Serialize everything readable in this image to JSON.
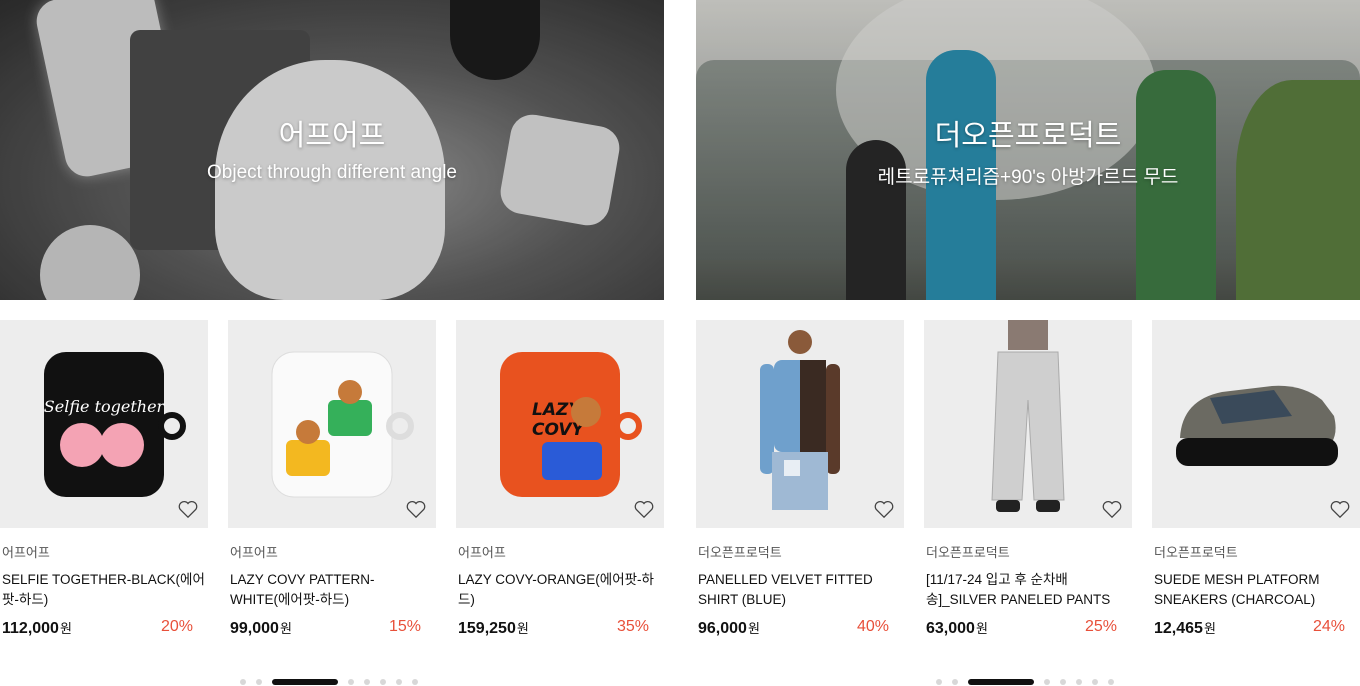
{
  "sections": [
    {
      "banner": {
        "title": "어프어프",
        "subtitle": "Object through different angle"
      },
      "products": [
        {
          "brand": "어프어프",
          "name": "SELFIE TOGETHER-BLACK(에어팟-하드)",
          "price": "112,000",
          "currency": "원",
          "discount": "20%",
          "thumb_color": "#111111",
          "thumb_icon": "airpods-case-icon"
        },
        {
          "brand": "어프어프",
          "name": "LAZY COVY PATTERN-WHITE(에어팟-하드)",
          "price": "99,000",
          "currency": "원",
          "discount": "15%",
          "thumb_color": "#f5f5f5",
          "thumb_icon": "airpods-case-icon"
        },
        {
          "brand": "어프어프",
          "name": "LAZY COVY-ORANGE(에어팟-하드)",
          "price": "159,250",
          "currency": "원",
          "discount": "35%",
          "thumb_color": "#e8521f",
          "thumb_icon": "airpods-case-icon"
        }
      ],
      "pager": {
        "count": 8,
        "active": 2
      }
    },
    {
      "banner": {
        "title": "더오픈프로덕트",
        "subtitle": "레트로퓨쳐리즘+90's 아방가르드 무드"
      },
      "products": [
        {
          "brand": "더오픈프로덕트",
          "name": "PANELLED VELVET FITTED SHIRT (BLUE)",
          "price": "96,000",
          "currency": "원",
          "discount": "40%",
          "thumb_color": "#6fa0cc",
          "thumb_icon": "shirt-icon"
        },
        {
          "brand": "더오픈프로덕트",
          "name": "[11/17-24 입고 후 순차배송]_SILVER PANELED PANTS",
          "price": "63,000",
          "currency": "원",
          "discount": "25%",
          "thumb_color": "#c9c9c9",
          "thumb_icon": "pants-icon"
        },
        {
          "brand": "더오픈프로덕트",
          "name": "SUEDE MESH PLATFORM SNEAKERS (CHARCOAL)",
          "price": "12,465",
          "currency": "원",
          "discount": "24%",
          "thumb_color": "#4b4b46",
          "thumb_icon": "sneaker-icon"
        }
      ],
      "pager": {
        "count": 8,
        "active": 2
      }
    }
  ],
  "colors": {
    "discount": "#e8503a",
    "pager_active": "#111111",
    "pager_inactive": "#d8d8d8",
    "thumb_bg": "#ededed"
  }
}
